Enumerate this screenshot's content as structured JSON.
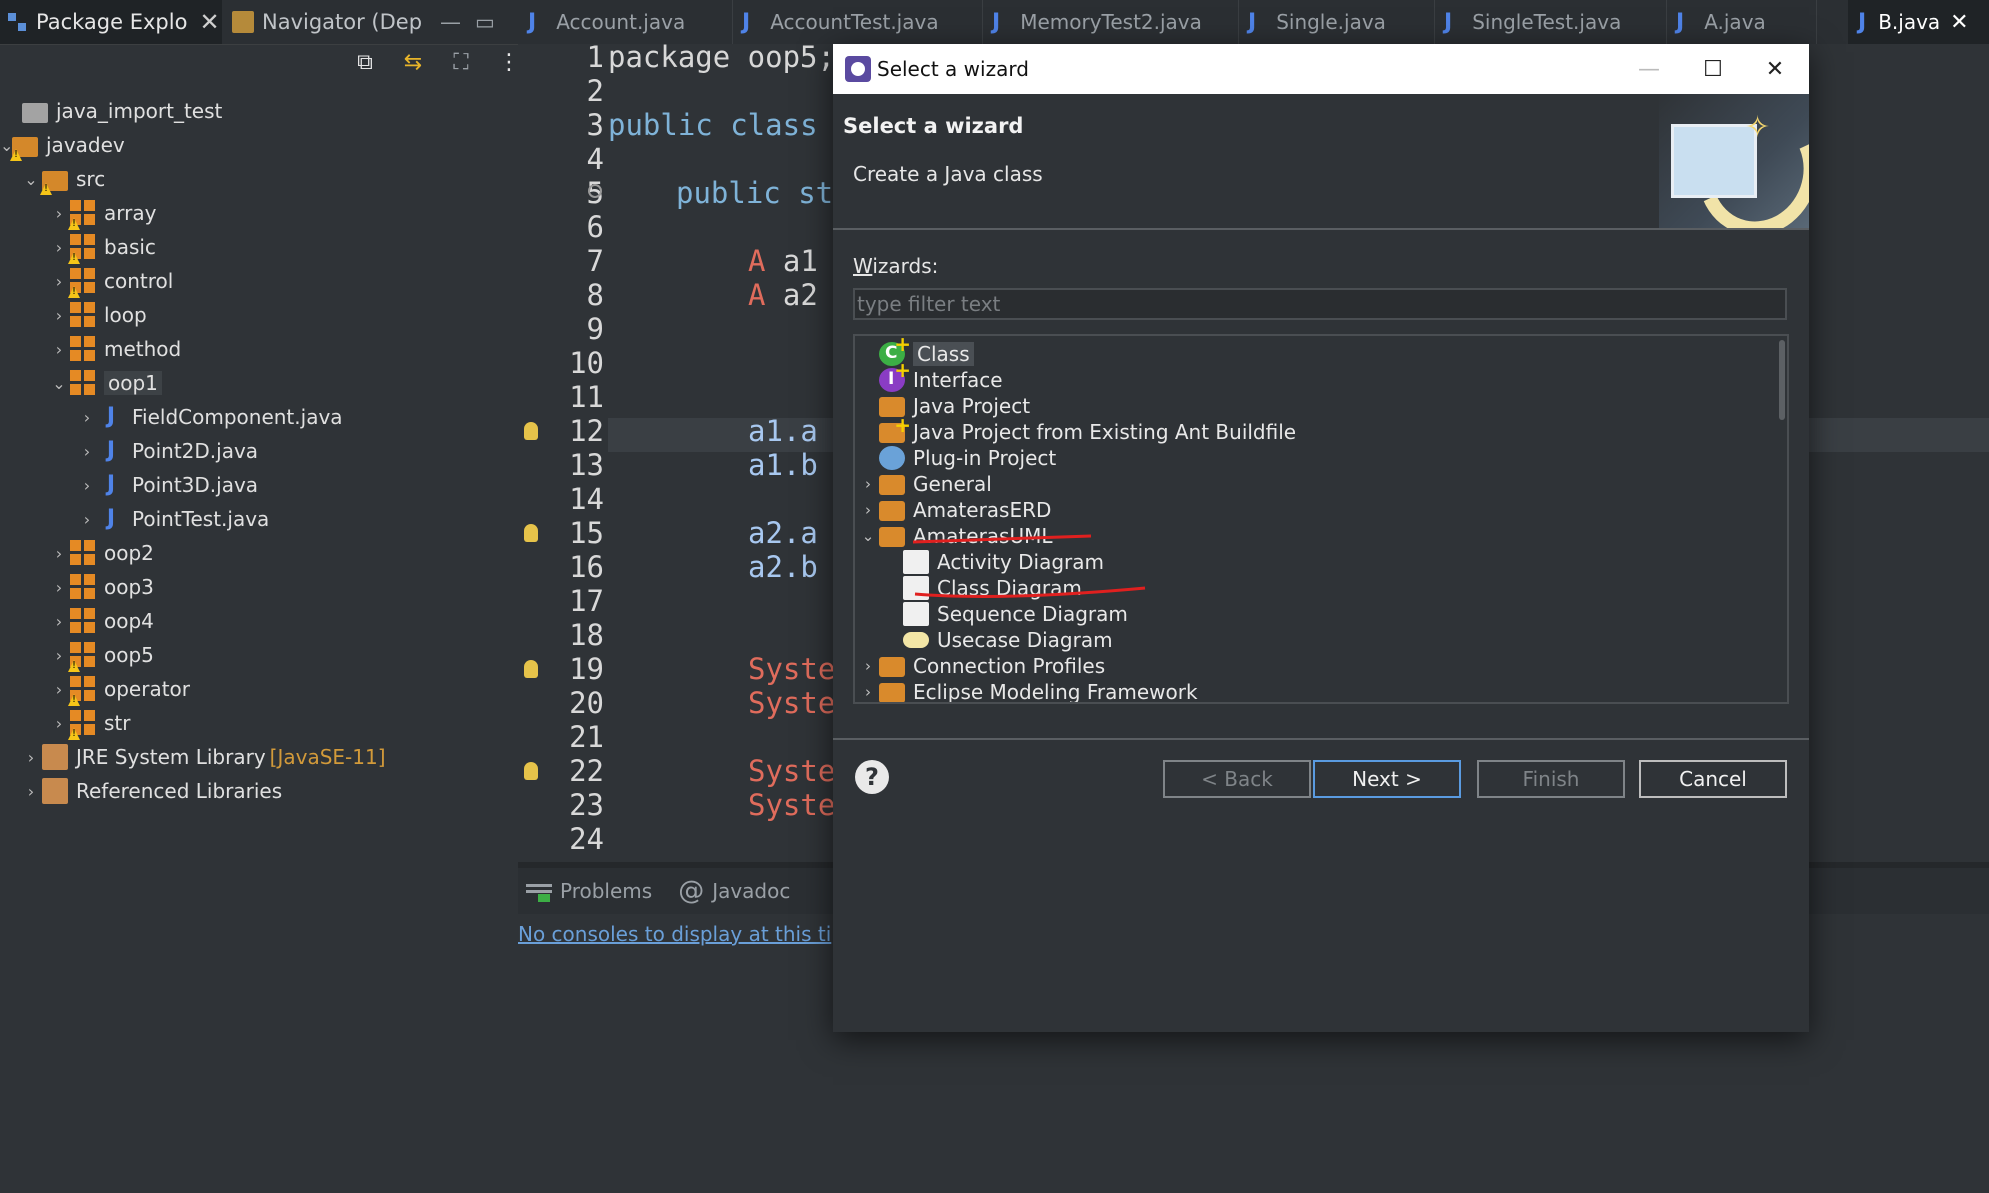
{
  "explorer": {
    "tab_package": "Package Explo",
    "tab_navigator": "Navigator (Dep",
    "tree": [
      {
        "label": "java_import_test",
        "kind": "folder"
      },
      {
        "label": "javadev",
        "kind": "project"
      },
      {
        "label": "src",
        "kind": "src"
      },
      {
        "label": "array",
        "kind": "pkg"
      },
      {
        "label": "basic",
        "kind": "pkg"
      },
      {
        "label": "control",
        "kind": "pkg"
      },
      {
        "label": "loop",
        "kind": "pkg"
      },
      {
        "label": "method",
        "kind": "pkg"
      },
      {
        "label": "oop1",
        "kind": "pkg"
      },
      {
        "label": "FieldComponent.java",
        "kind": "java"
      },
      {
        "label": "Point2D.java",
        "kind": "java"
      },
      {
        "label": "Point3D.java",
        "kind": "java"
      },
      {
        "label": "PointTest.java",
        "kind": "java"
      },
      {
        "label": "oop2",
        "kind": "pkg"
      },
      {
        "label": "oop3",
        "kind": "pkg"
      },
      {
        "label": "oop4",
        "kind": "pkg"
      },
      {
        "label": "oop5",
        "kind": "pkg"
      },
      {
        "label": "operator",
        "kind": "pkg"
      },
      {
        "label": "str",
        "kind": "pkg"
      },
      {
        "label": "JRE System Library",
        "kind": "lib",
        "suffix": "[JavaSE-11]"
      },
      {
        "label": "Referenced Libraries",
        "kind": "lib"
      }
    ]
  },
  "editor": {
    "tabs": [
      "Account.java",
      "AccountTest.java",
      "MemoryTest2.java",
      "Single.java",
      "SingleTest.java",
      "A.java",
      "B.java"
    ],
    "active_tab": "B.java",
    "line_numbers": [
      "1",
      "2",
      "3",
      "4",
      "5",
      "6",
      "7",
      "8",
      "9",
      "10",
      "11",
      "12",
      "13",
      "14",
      "15",
      "16",
      "17",
      "18",
      "19",
      "20",
      "21",
      "22",
      "23",
      "24"
    ],
    "code": {
      "l1a": "package",
      "l1b": " oop5;",
      "l3a": "public",
      "l3b": " class",
      "l5a": "public",
      "l5b": " st",
      "l7a": "A",
      "l7b": " a1",
      "l8a": "A",
      "l8b": " a2",
      "l11": "a1.a",
      "l12": "a1.b",
      "l14": "a2.a",
      "l15": "a2.b",
      "l18": "Syster",
      "l19": "Syster",
      "l21": "Syster",
      "l22": "Syster"
    }
  },
  "console": {
    "tab_problems": "Problems",
    "tab_javadoc": "Javadoc",
    "message": "No consoles to display at this ti"
  },
  "dialog": {
    "title": "Select a wizard",
    "heading": "Select a wizard",
    "description": "Create a Java class",
    "wizards_label_first": "W",
    "wizards_label_rest": "izards:",
    "filter_placeholder": "type filter text",
    "items": {
      "class": "Class",
      "interface": "Interface",
      "java_project": "Java Project",
      "java_project_ant": "Java Project from Existing Ant Buildfile",
      "plugin_project": "Plug-in Project",
      "general": "General",
      "amateras_erd": "AmaterasERD",
      "amateras_uml": "AmaterasUML",
      "activity_diagram": "Activity Diagram",
      "class_diagram": "Class Diagram",
      "sequence_diagram": "Sequence Diagram",
      "usecase_diagram": "Usecase Diagram",
      "connection_profiles": "Connection Profiles",
      "emf": "Eclipse Modeling Framework"
    },
    "buttons": {
      "back": "< Back",
      "next": "Next >",
      "finish": "Finish",
      "cancel": "Cancel"
    }
  },
  "colors": {
    "annotation": "#e0201f",
    "accent": "#5a9be0"
  }
}
